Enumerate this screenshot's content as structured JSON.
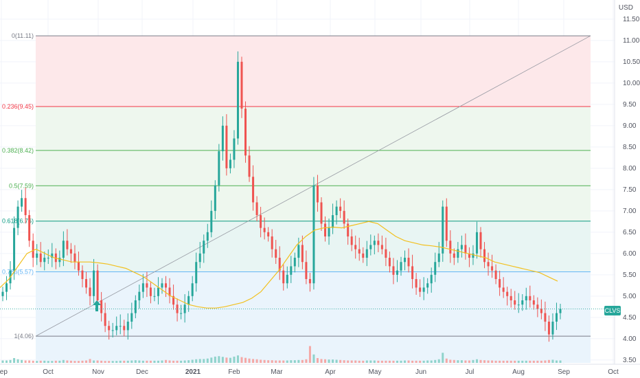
{
  "currency_label": "USD",
  "symbol_label": "CLVS",
  "colors": {
    "up": "#26a69a",
    "down": "#ef5350",
    "sma": "#f2c01e",
    "grid": "#f0f3fa",
    "axis_text": "#50535e",
    "symbol_bg": "#26a69a",
    "arrow": "#26a69a"
  },
  "chart_data": {
    "type": "candlestick",
    "y_axis": {
      "min": 3.4,
      "max": 11.95,
      "ticks": [
        "11.50",
        "11.00",
        "10.50",
        "10.00",
        "9.50",
        "9.00",
        "8.50",
        "8.00",
        "7.50",
        "7.00",
        "6.50",
        "6.00",
        "5.50",
        "5.00",
        "4.50",
        "4.00",
        "3.50"
      ]
    },
    "x_axis": {
      "ticks": [
        "Sep",
        "Oct",
        "Nov",
        "Dec",
        "2021",
        "Feb",
        "Mar",
        "Apr",
        "May",
        "Jun",
        "Jul",
        "Aug",
        "Sep",
        "Oct"
      ]
    },
    "last_price": 4.7,
    "fib_levels": [
      {
        "label": "0(11.11)",
        "value": 11.11,
        "color": "#787b86"
      },
      {
        "label": "0.236(9.45)",
        "value": 9.45,
        "color": "#f23645"
      },
      {
        "label": "0.382(8.42)",
        "value": 8.42,
        "color": "#4caf50"
      },
      {
        "label": "0.5(7.59)",
        "value": 7.59,
        "color": "#4caf50"
      },
      {
        "label": "0.618(6.76)",
        "value": 6.76,
        "color": "#089981"
      },
      {
        "label": "0.786(5.57)",
        "value": 5.57,
        "color": "#64b5f6"
      },
      {
        "label": "1(4.06)",
        "value": 4.06,
        "color": "#787b86"
      }
    ],
    "fib_bands": [
      "#fde8ea",
      "#eef7ee",
      "#eef7ee",
      "#eef7ee",
      "#e8f5f3",
      "#eaf4fc"
    ],
    "trend_line": {
      "start": {
        "date_index": 0,
        "value": 4.06
      },
      "end": {
        "date_index": 1,
        "value": 11.11
      }
    },
    "closes": [
      5.1,
      5.3,
      5.6,
      6.6,
      7.1,
      7.3,
      6.9,
      6.3,
      5.9,
      6.0,
      5.8,
      5.9,
      5.9,
      6.0,
      5.8,
      5.9,
      6.3,
      6.1,
      6.0,
      5.8,
      5.6,
      5.4,
      5.2,
      5.0,
      5.6,
      4.9,
      4.6,
      4.3,
      4.2,
      4.2,
      4.3,
      4.3,
      4.2,
      4.4,
      4.6,
      4.9,
      5.1,
      5.3,
      5.2,
      5.0,
      5.0,
      5.2,
      5.3,
      5.2,
      5.0,
      4.8,
      4.6,
      4.6,
      4.8,
      5.0,
      5.3,
      5.8,
      6.0,
      6.3,
      6.5,
      7.0,
      7.6,
      8.4,
      9.0,
      8.0,
      8.2,
      8.7,
      10.5,
      9.4,
      8.3,
      7.8,
      7.2,
      6.9,
      6.6,
      6.5,
      6.4,
      6.1,
      5.9,
      5.6,
      5.3,
      5.5,
      5.7,
      5.9,
      6.2,
      5.8,
      5.4,
      5.3,
      7.6,
      7.2,
      6.7,
      6.4,
      6.6,
      6.9,
      7.1,
      7.0,
      6.7,
      6.4,
      6.2,
      6.1,
      6.0,
      5.9,
      6.1,
      6.2,
      6.3,
      6.2,
      6.1,
      5.9,
      5.7,
      5.5,
      5.6,
      5.8,
      5.9,
      5.7,
      5.4,
      5.2,
      5.1,
      5.2,
      5.3,
      5.5,
      5.8,
      6.0,
      7.1,
      6.3,
      6.0,
      5.9,
      6.1,
      6.2,
      6.0,
      5.9,
      6.0,
      6.5,
      6.1,
      5.8,
      5.7,
      5.6,
      5.4,
      5.2,
      5.1,
      5.0,
      4.9,
      4.8,
      4.8,
      4.9,
      5.0,
      4.9,
      4.8,
      4.7,
      4.6,
      4.4,
      4.1,
      4.4,
      4.6,
      4.7
    ],
    "volumes": [
      1,
      1,
      1.2,
      2,
      1.5,
      1.2,
      1,
      1,
      0.9,
      0.8,
      0.9,
      0.9,
      0.8,
      0.8,
      0.9,
      0.9,
      1.2,
      1,
      0.9,
      0.8,
      0.8,
      0.9,
      1,
      1.6,
      1,
      1,
      0.9,
      0.8,
      0.8,
      0.8,
      0.8,
      0.9,
      0.9,
      0.9,
      1,
      1.1,
      1,
      0.9,
      0.9,
      0.9,
      0.9,
      0.9,
      1,
      1.2,
      1,
      0.9,
      0.9,
      0.9,
      1,
      1.1,
      1.3,
      1.5,
      1.6,
      1.6,
      1.8,
      2.2,
      2.6,
      2.8,
      2.5,
      2.2,
      2.1,
      2.6,
      3.1,
      2.4,
      2.1,
      1.8,
      1.6,
      1.5,
      1.3,
      1.2,
      1.1,
      1.1,
      1,
      1,
      1,
      1,
      1.1,
      1.1,
      1.2,
      1.2,
      1.5,
      7,
      3.5,
      2,
      1.6,
      1.5,
      1.4,
      1.4,
      1.3,
      1.2,
      1.1,
      1,
      1,
      1,
      0.9,
      0.9,
      1,
      1,
      1,
      0.9,
      0.9,
      0.9,
      0.9,
      0.9,
      0.9,
      0.9,
      1,
      1,
      0.9,
      0.9,
      0.9,
      0.9,
      1,
      1,
      1.2,
      1.5,
      4.2,
      1.8,
      1.3,
      1.2,
      1.1,
      1.1,
      1,
      1,
      1.2,
      1.5,
      1.2,
      1.1,
      1,
      1,
      0.9,
      0.9,
      0.9,
      0.9,
      0.9,
      0.9,
      0.9,
      0.9,
      0.9,
      0.9,
      0.9,
      0.9,
      0.9,
      1,
      1.2,
      1.3,
      1,
      1
    ],
    "sma": [
      5.2,
      5.4,
      5.7,
      6.0,
      6.1,
      6.0,
      5.9,
      5.85,
      5.8,
      5.8,
      5.8,
      5.78,
      5.75,
      5.7,
      5.65,
      5.55,
      5.45,
      5.3,
      5.15,
      5.0,
      4.9,
      4.8,
      4.75,
      4.72,
      4.72,
      4.75,
      4.8,
      4.85,
      4.95,
      5.1,
      5.35,
      5.6,
      5.9,
      6.2,
      6.4,
      6.55,
      6.6,
      6.62,
      6.6,
      6.65,
      6.7,
      6.75,
      6.7,
      6.55,
      6.4,
      6.3,
      6.25,
      6.2,
      6.18,
      6.15,
      6.1,
      6.05,
      6.0,
      5.95,
      5.9,
      5.8,
      5.75,
      5.7,
      5.65,
      5.6,
      5.55,
      5.45,
      5.35
    ],
    "up_arrow": {
      "date_index": 0
    }
  }
}
